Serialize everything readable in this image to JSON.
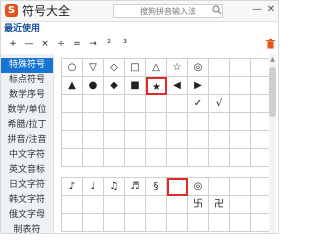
{
  "app": {
    "logo": "S",
    "title": "符号大全"
  },
  "search": {
    "placeholder": "搜狗拼音输入法"
  },
  "window": {
    "minimize": "—",
    "close": "✕"
  },
  "recent": {
    "label": "最近使用",
    "symbols": [
      "+",
      "—",
      "×",
      "÷",
      "=",
      "→",
      "²",
      "³"
    ]
  },
  "sidebar": {
    "items": [
      "特殊符号",
      "标点符号",
      "数学序号",
      "数学/单位",
      "希腊/拉丁",
      "拼音/注音",
      "中文字符",
      "英文音标",
      "日文字符",
      "韩文字符",
      "俄文字母",
      "制表符"
    ],
    "active_index": 0
  },
  "grid1": {
    "rows": [
      [
        "○",
        "▽",
        "◇",
        "□",
        "△",
        "☆",
        "◎",
        "",
        "",
        ""
      ],
      [
        "▲",
        "●",
        "◆",
        "■",
        "★",
        "◀",
        "▶",
        "",
        "",
        ""
      ],
      [
        "",
        "",
        "",
        "",
        "",
        "",
        "✓",
        "√",
        "",
        ""
      ],
      [
        "",
        "",
        "",
        "",
        "",
        "",
        "",
        "",
        "",
        ""
      ],
      [
        "",
        "",
        "",
        "",
        "",
        "",
        "",
        "",
        "",
        ""
      ],
      [
        "",
        "",
        "",
        "",
        "",
        "",
        "",
        "",
        "",
        ""
      ]
    ],
    "highlight": [
      1,
      4
    ]
  },
  "grid2": {
    "rows": [
      [
        "♪",
        "♩",
        "♫",
        "♬",
        "§",
        "",
        "◎",
        "",
        "",
        ""
      ],
      [
        "",
        "",
        "",
        "",
        "",
        "",
        "卐",
        "卍",
        "",
        ""
      ],
      [
        "",
        "",
        "",
        "",
        "",
        "",
        "",
        "",
        "",
        ""
      ]
    ],
    "highlight": [
      0,
      5
    ]
  },
  "colors": {
    "accent": "#1875d1",
    "logo": "#e0531f",
    "highlight": "#e02a2a"
  }
}
